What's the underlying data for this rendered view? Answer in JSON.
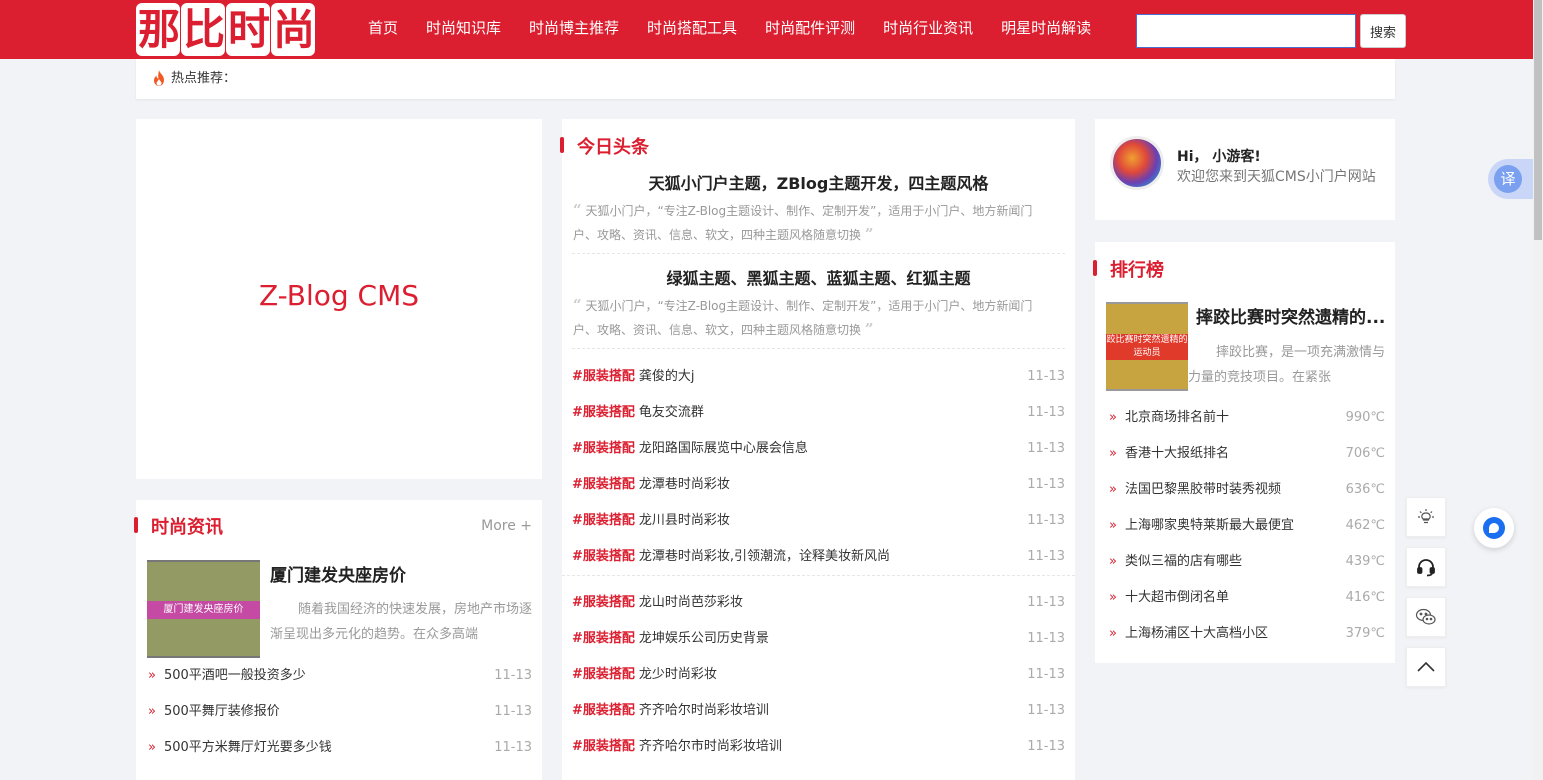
{
  "brand": {
    "logo_text": "那比时尚"
  },
  "nav": [
    {
      "label": "首页"
    },
    {
      "label": "时尚知识库"
    },
    {
      "label": "时尚博主推荐"
    },
    {
      "label": "时尚搭配工具"
    },
    {
      "label": "时尚配件评测"
    },
    {
      "label": "时尚行业资讯"
    },
    {
      "label": "明星时尚解读"
    }
  ],
  "search": {
    "value": "",
    "placeholder": "",
    "button_label": "搜索"
  },
  "hotbar": {
    "icon": "fire-icon",
    "label": "热点推荐："
  },
  "banner": {
    "text": "Z-Blog CMS"
  },
  "fashion_news": {
    "title": "时尚资讯",
    "more": "More +",
    "feature": {
      "thumb_caption": "厦门建发央座房价",
      "title": "厦门建发央座房价",
      "desc": "随着我国经济的快速发展，房地产市场逐渐呈现出多元化的趋势。在众多高端"
    },
    "items": [
      {
        "title": "500平酒吧一般投资多少",
        "date": "11-13"
      },
      {
        "title": "500平舞厅装修报价",
        "date": "11-13"
      },
      {
        "title": "500平方米舞厅灯光要多少钱",
        "date": "11-13"
      }
    ]
  },
  "headlines": {
    "title": "今日头条",
    "top": [
      {
        "title": "天狐小门户主题，ZBlog主题开发，四主题风格",
        "desc": "天狐小门户，“专注Z-Blog主题设计、制作、定制开发”，适用于小门户、地方新闻门户、攻略、资讯、信息、软文，四种主题风格随意切换"
      },
      {
        "title": "绿狐主题、黑狐主题、蓝狐主题、红狐主题",
        "desc": "天狐小门户，“专注Z-Blog主题设计、制作、定制开发”，适用于小门户、地方新闻门户、攻略、资讯、信息、软文，四种主题风格随意切换"
      }
    ],
    "group1": [
      {
        "tag": "#服装搭配",
        "title": "龚俊的大j",
        "date": "11-13"
      },
      {
        "tag": "#服装搭配",
        "title": "龟友交流群",
        "date": "11-13"
      },
      {
        "tag": "#服装搭配",
        "title": "龙阳路国际展览中心展会信息",
        "date": "11-13"
      },
      {
        "tag": "#服装搭配",
        "title": "龙潭巷时尚彩妆",
        "date": "11-13"
      },
      {
        "tag": "#服装搭配",
        "title": "龙川县时尚彩妆",
        "date": "11-13"
      },
      {
        "tag": "#服装搭配",
        "title": "龙潭巷时尚彩妆,引领潮流，诠释美妆新风尚",
        "date": "11-13"
      }
    ],
    "group2": [
      {
        "tag": "#服装搭配",
        "title": "龙山时尚芭莎彩妆",
        "date": "11-13"
      },
      {
        "tag": "#服装搭配",
        "title": "龙坤娱乐公司历史背景",
        "date": "11-13"
      },
      {
        "tag": "#服装搭配",
        "title": "龙少时尚彩妆",
        "date": "11-13"
      },
      {
        "tag": "#服装搭配",
        "title": "齐齐哈尔时尚彩妆培训",
        "date": "11-13"
      },
      {
        "tag": "#服装搭配",
        "title": "齐齐哈尔市时尚彩妆培训",
        "date": "11-13"
      }
    ]
  },
  "welcome": {
    "hi": "Hi， 小游客!",
    "message": "欢迎您来到天狐CMS小门户网站"
  },
  "ranking": {
    "title": "排行榜",
    "feature": {
      "thumb_caption": "跤比赛时突然遗精的运动员",
      "title": "摔跤比赛时突然遗精的...",
      "desc": "摔跤比赛，是一项充满激情与力量的竞技项目。在紧张"
    },
    "items": [
      {
        "title": "北京商场排名前十",
        "heat": "990℃"
      },
      {
        "title": "香港十大报纸排名",
        "heat": "706℃"
      },
      {
        "title": "法国巴黎黑胶带时装秀视频",
        "heat": "636℃"
      },
      {
        "title": "上海哪家奥特莱斯最大最便宜",
        "heat": "462℃"
      },
      {
        "title": "类似三福的店有哪些",
        "heat": "439℃"
      },
      {
        "title": "十大超市倒闭名单",
        "heat": "416℃"
      },
      {
        "title": "上海杨浦区十大高档小区",
        "heat": "379℃"
      }
    ]
  },
  "floating": {
    "translate_label": "译"
  },
  "colors": {
    "brand": "#dc1f30",
    "background": "#f2f3f7"
  }
}
